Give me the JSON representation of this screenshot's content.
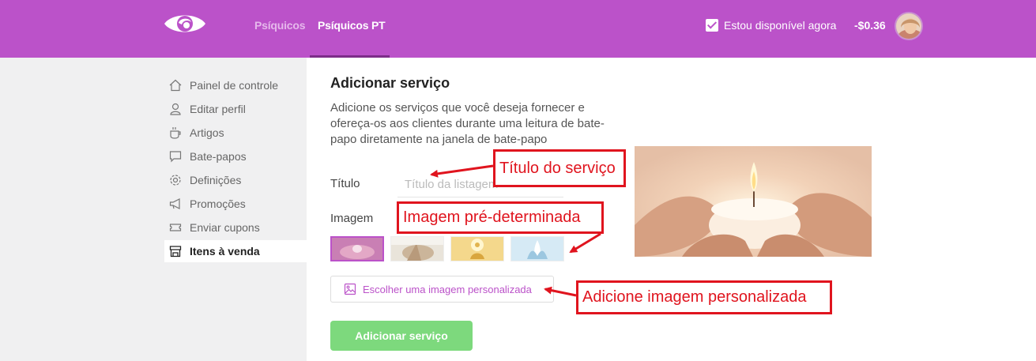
{
  "header": {
    "nav": [
      "Psíquicos",
      "Psíquicos PT"
    ],
    "availability_label": "Estou disponível agora",
    "availability_checked": true,
    "balance": "-$0.36",
    "brand_color": "#bb52c9"
  },
  "sidebar": {
    "items": [
      {
        "label": "Painel de controle",
        "icon": "home-icon"
      },
      {
        "label": "Editar perfil",
        "icon": "user-icon"
      },
      {
        "label": "Artigos",
        "icon": "cup-icon"
      },
      {
        "label": "Bate-papos",
        "icon": "chat-icon"
      },
      {
        "label": "Definições",
        "icon": "gear-icon"
      },
      {
        "label": "Promoções",
        "icon": "megaphone-icon"
      },
      {
        "label": "Enviar cupons",
        "icon": "ticket-icon"
      },
      {
        "label": "Itens à venda",
        "icon": "store-icon",
        "active": true
      }
    ]
  },
  "main": {
    "title": "Adicionar serviço",
    "description": "Adicione os serviços que você deseja fornecer e ofereça-os aos clientes durante uma leitura de bate-papo diretamente na janela de bate-papo",
    "title_label": "Título",
    "title_placeholder": "Título da listagem",
    "image_label": "Imagem",
    "custom_image_button": "Escolher uma imagem personalizada",
    "submit_button": "Adicionar serviço"
  },
  "annotations": {
    "title_callout": "Título do serviço",
    "image_callout": "Imagem pré-determinada",
    "custom_callout": "Adicione imagem personalizada"
  }
}
